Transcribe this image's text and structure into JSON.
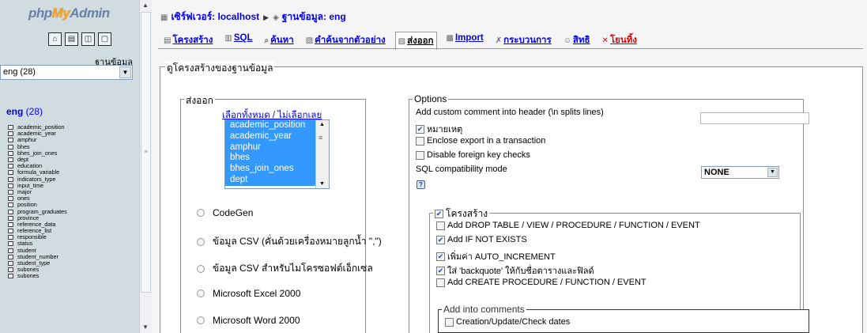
{
  "nav": {
    "logo": {
      "part1": "php",
      "part2": "My",
      "part3": "Admin"
    },
    "icons": [
      "home-icon",
      "sql-query-icon",
      "docs-icon",
      "reload-icon"
    ],
    "db_label": "ฐานข้อมูล",
    "db_select": "eng (28)",
    "db_name": "eng",
    "db_count": " (28)",
    "tables": [
      "academic_position",
      "academic_year",
      "amphur",
      "bhes",
      "bhes_join_ones",
      "dept",
      "education",
      "formula_variable",
      "indicators_type",
      "input_time",
      "major",
      "ones",
      "position",
      "program_graduates",
      "province",
      "reference_data",
      "reference_list",
      "responsible",
      "status",
      "student",
      "student_number",
      "student_type",
      "subones",
      "subones"
    ]
  },
  "breadcrumb": {
    "server": "เซิร์ฟเวอร์: localhost",
    "database": "ฐานข้อมูล: eng"
  },
  "tabs": [
    {
      "label": "โครงสร้าง",
      "icon": "structure-icon"
    },
    {
      "label": "SQL",
      "icon": "sql-icon"
    },
    {
      "label": "ค้นหา",
      "icon": "search-icon"
    },
    {
      "label": "คำค้นจากตัวอย่าง",
      "icon": "query-icon"
    },
    {
      "label": "ส่งออก",
      "icon": "export-icon"
    },
    {
      "label": "Import",
      "icon": "import-icon"
    },
    {
      "label": "กระบวนการ",
      "icon": "operations-icon"
    },
    {
      "label": "สิทธิ",
      "icon": "privileges-icon"
    },
    {
      "label": "โยนทิ้ง",
      "icon": "drop-icon"
    }
  ],
  "main": {
    "fieldset_title": "ดูโครงสร้างของฐานข้อมูล",
    "export": {
      "legend": "ส่งออก",
      "select_all": "เลือกทั้งหมด / ไม่เลือกเลย",
      "list_items": [
        "academic_position",
        "academic_year",
        "amphur",
        "bhes",
        "bhes_join_ones",
        "dept"
      ],
      "formats": [
        "CodeGen",
        "ข้อมูล CSV (คั่นด้วยเครื่องหมายลูกน้ำ \",\")",
        "ข้อมูล CSV สำหรับไมโครซอฟต์เอ็กเซล",
        "Microsoft Excel 2000",
        "Microsoft Word 2000"
      ]
    },
    "options": {
      "legend": "Options",
      "comment_header_label": "Add custom comment into header (\\n splits lines)",
      "comment_header_value": "",
      "checkboxes": [
        {
          "label": "หมายเหตุ",
          "checked": true
        },
        {
          "label": "Enclose export in a transaction",
          "checked": false
        },
        {
          "label": "Disable foreign key checks",
          "checked": false
        }
      ],
      "compat_label": "SQL compatibility mode",
      "compat_value": "NONE",
      "structure": {
        "legend": "โครงสร้าง",
        "checked": true,
        "items": [
          {
            "label": "Add DROP TABLE / VIEW / PROCEDURE / FUNCTION / EVENT",
            "checked": false
          },
          {
            "label": "Add IF NOT EXISTS",
            "checked": true
          },
          {
            "label": "เพิ่มค่า AUTO_INCREMENT",
            "checked": true
          },
          {
            "label": "ใส่ 'backquote' ให้กับชื่อตารางและฟิลด์",
            "checked": true
          },
          {
            "label": "Add CREATE PROCEDURE / FUNCTION / EVENT",
            "checked": false
          }
        ],
        "comments": {
          "legend": "Add into comments",
          "item": "Creation/Update/Check dates",
          "checked": false
        }
      }
    }
  }
}
